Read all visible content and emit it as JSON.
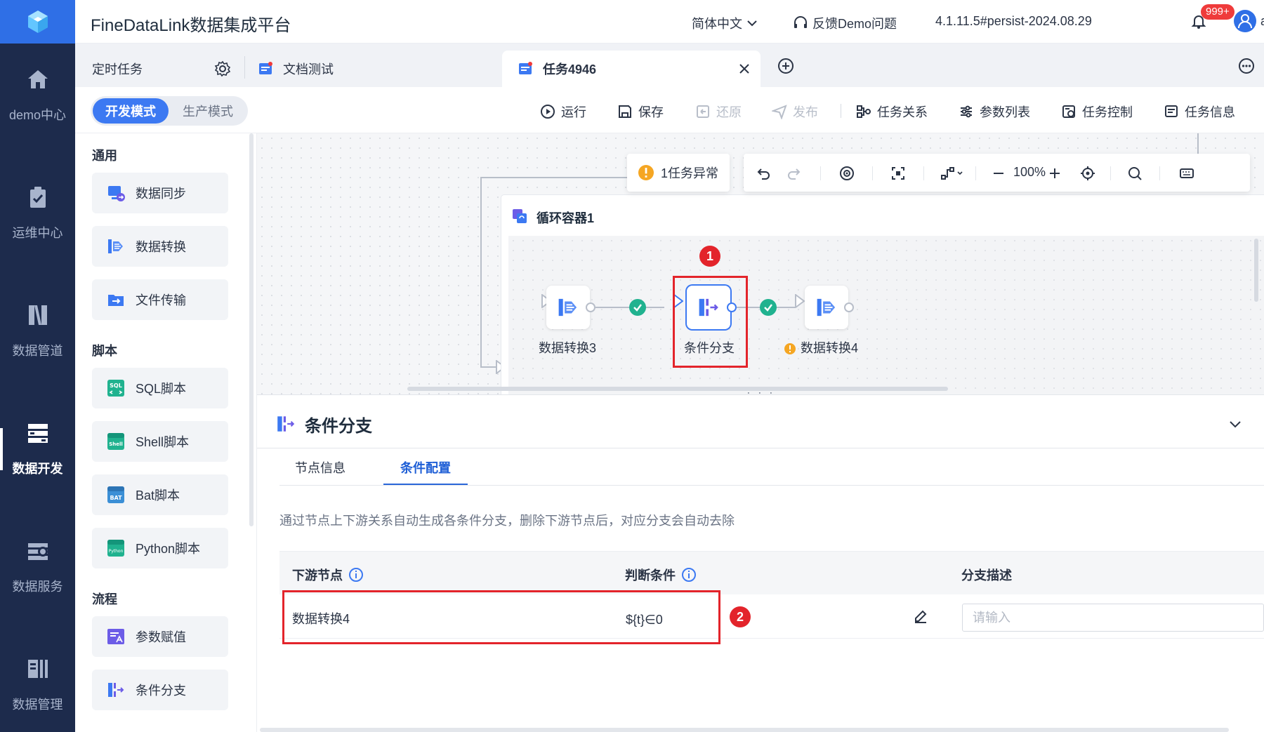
{
  "rail": {
    "items": [
      {
        "label": "demo中心",
        "icon": "home-icon"
      },
      {
        "label": "运维中心",
        "icon": "clipboard-check-icon"
      },
      {
        "label": "数据管道",
        "icon": "pipeline-icon"
      },
      {
        "label": "数据开发",
        "icon": "data-dev-icon",
        "active": true
      },
      {
        "label": "数据服务",
        "icon": "data-service-icon"
      },
      {
        "label": "数据管理",
        "icon": "data-manage-icon"
      }
    ]
  },
  "header": {
    "title": "FineDataLink数据集成平台",
    "language": "简体中文",
    "feedback": "反馈Demo问题",
    "version": "4.1.11.5#persist-2024.08.29",
    "notification_count": "999+",
    "user": "admin"
  },
  "tabs": {
    "pinned": "定时任务",
    "items": [
      {
        "label": "文档测试"
      },
      {
        "label": "任务4946",
        "active": true
      }
    ]
  },
  "toolbar": {
    "mode_dev": "开发模式",
    "mode_prod": "生产模式",
    "run": "运行",
    "save": "保存",
    "restore": "还原",
    "publish": "发布",
    "relations": "任务关系",
    "params": "参数列表",
    "control": "任务控制",
    "info": "任务信息"
  },
  "palette": {
    "general_title": "通用",
    "general": [
      "数据同步",
      "数据转换",
      "文件传输"
    ],
    "script_title": "脚本",
    "scripts": [
      "SQL脚本",
      "Shell脚本",
      "Bat脚本",
      "Python脚本"
    ],
    "flow_title": "流程",
    "flows": [
      "参数赋值",
      "条件分支"
    ],
    "icon_text": {
      "sql": "SQL",
      "shell": "Shell",
      "bat": "BAT",
      "python": "Python"
    }
  },
  "canvas": {
    "warning_chip": "1任务异常",
    "zoom": "100%",
    "container_title": "循环容器1",
    "nodes": [
      {
        "label": "数据转换3",
        "icon": "data-transform-icon"
      },
      {
        "label": "条件分支",
        "icon": "condition-branch-icon",
        "selected": true
      },
      {
        "label": "数据转换4",
        "icon": "data-transform-icon",
        "warning": true
      }
    ],
    "callouts": [
      "1",
      "2"
    ]
  },
  "panel": {
    "title": "条件分支",
    "tab_node_info": "节点信息",
    "tab_condition": "条件配置",
    "hint": "通过节点上下游关系自动生成各条件分支，删除下游节点后，对应分支会自动去除",
    "columns": [
      "下游节点",
      "判断条件",
      "分支描述"
    ],
    "rows": [
      {
        "node": "数据转换4",
        "condition": "${t}∈0",
        "description": ""
      }
    ],
    "desc_placeholder": "请输入"
  },
  "colors": {
    "rail_bg": "#1d2b4c",
    "brand": "#2f6fe6",
    "accent": "#3c79f2",
    "success": "#20b28f",
    "warning": "#f5a623",
    "callout_red": "#e3242b"
  }
}
